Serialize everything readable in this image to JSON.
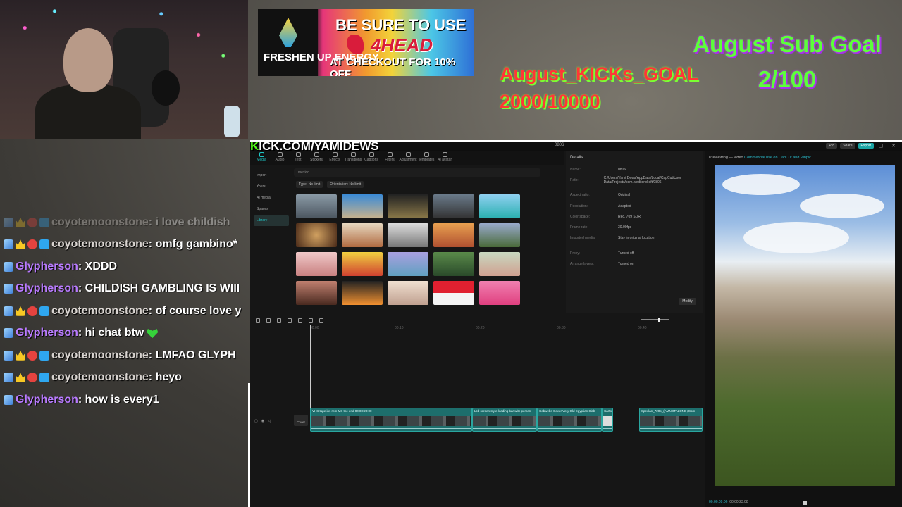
{
  "ad": {
    "brand": "FRESHEN UP ENERGY",
    "line1": "BE SURE TO USE",
    "code": "4HEAD",
    "line3": "AT CHECKOUT FOR 10% OFF"
  },
  "goals": {
    "kicks_title": "August_KICKs_GOAL",
    "kicks_value": "2000/10000",
    "sub_title": "August Sub Goal",
    "sub_value": "2/100"
  },
  "chat": [
    {
      "user": "coyotemoonstone",
      "text": ": i love childish ",
      "badges": [
        "sword",
        "crown",
        "fox",
        "cube"
      ],
      "faded": true,
      "color": "coy"
    },
    {
      "user": "coyotemoonstone",
      "text": ": omfg gambino*",
      "badges": [
        "sword",
        "crown",
        "fox",
        "cube"
      ],
      "faded": false,
      "color": "coy"
    },
    {
      "user": "Glypherson",
      "text": ": XDDD",
      "badges": [
        "sword"
      ],
      "faded": false,
      "color": "gly"
    },
    {
      "user": "Glypherson",
      "text": ": CHILDISH GAMBLING IS WIII",
      "badges": [
        "sword"
      ],
      "faded": false,
      "color": "gly"
    },
    {
      "user": "coyotemoonstone",
      "text": ": of course love y",
      "badges": [
        "sword",
        "crown",
        "fox",
        "cube"
      ],
      "faded": false,
      "color": "coy"
    },
    {
      "user": "Glypherson",
      "text": ": hi chat btw",
      "badges": [
        "sword"
      ],
      "faded": false,
      "color": "gly",
      "heart": true
    },
    {
      "user": "coyotemoonstone",
      "text": ": LMFAO GLYPH",
      "badges": [
        "sword",
        "crown",
        "fox",
        "cube"
      ],
      "faded": false,
      "color": "coy"
    },
    {
      "user": "coyotemoonstone",
      "text": ": heyo",
      "badges": [
        "sword",
        "crown",
        "fox",
        "cube"
      ],
      "faded": false,
      "color": "coy"
    },
    {
      "user": "Glypherson",
      "text": ": how is every1",
      "badges": [
        "sword"
      ],
      "faded": false,
      "color": "gly"
    }
  ],
  "kick": {
    "k": "K",
    "rest": "ICK.COM/YAMIDEWS"
  },
  "editor": {
    "title": "0806",
    "top_buttons": [
      "Pro",
      "Share",
      "Export"
    ],
    "tools": [
      "Media",
      "Audio",
      "Text",
      "Stickers",
      "Effects",
      "Transitions",
      "Captions",
      "Filters",
      "Adjustment",
      "Templates",
      "AI avatar"
    ],
    "sidebar": [
      "Import",
      "Yours",
      "AI media",
      "Spaces",
      "Library"
    ],
    "search": "mexico",
    "filter_type": "Type: No limit",
    "filter_orient": "Orientation: No limit",
    "details_title": "Details",
    "details": [
      {
        "k": "Name:",
        "v": "0806"
      },
      {
        "k": "Path:",
        "v": "C:/Users/Yami Dews/AppData/Local/CapCut/User Data/Projects/com.lveditor.draft/0806"
      },
      {
        "k": "Aspect ratio:",
        "v": "Original"
      },
      {
        "k": "Resolution:",
        "v": "Adapted"
      },
      {
        "k": "Color space:",
        "v": "Rec. 709 SDR"
      },
      {
        "k": "Frame rate:",
        "v": "30.00fps"
      },
      {
        "k": "Imported media:",
        "v": "Stay in original location"
      },
      {
        "k": "Proxy:",
        "v": "Turned off"
      },
      {
        "k": "Arrange layers:",
        "v": "Turned on"
      }
    ],
    "modify": "Modify",
    "preview_label": "Previewing — video",
    "preview_tag": "Commercial use on CapCut and Pinpic",
    "time": "00:00:09:06",
    "duration": "00:00:23:08",
    "ruler": [
      "00:00",
      "00:10",
      "00:20",
      "00:30",
      "00:40"
    ],
    "cover": "Cover",
    "clips": [
      "VHS tape ins rem MS the end  00:00:20:00",
      "Lcd screen style loading bar with percen",
      "Cobwebs Cover Very Old Egyptian Slab",
      "Carto",
      "Speclan_720p_(AMNOTALONE (Com"
    ]
  }
}
